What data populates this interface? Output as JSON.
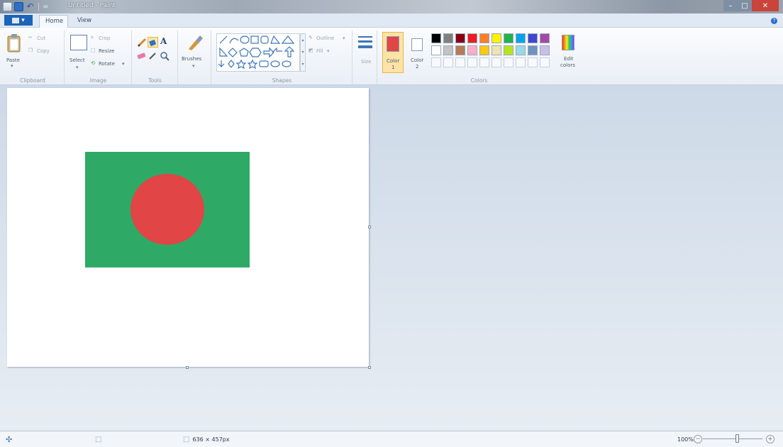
{
  "window": {
    "title": "Untitled - Paint",
    "minimize": "–",
    "maximize": "□",
    "close": "✕"
  },
  "quick_access": {
    "dropdown": "="
  },
  "tabs": {
    "file_label": "▾",
    "home_label": "Home",
    "view_label": "View",
    "help": "?"
  },
  "ribbon": {
    "clipboard": {
      "label": "Clipboard",
      "paste": "Paste",
      "cut": "Cut",
      "copy": "Copy"
    },
    "image": {
      "label": "Image",
      "select": "Select",
      "crop": "Crop",
      "resize": "Resize",
      "rotate": "Rotate"
    },
    "tools": {
      "label": "Tools",
      "text_tool": "A"
    },
    "brushes": {
      "label": "Brushes"
    },
    "shapes": {
      "label": "Shapes",
      "outline": "Outline",
      "fill": "Fill"
    },
    "size": {
      "label": "Size"
    },
    "colors": {
      "label": "Colors",
      "color1_label": "Color",
      "color1_num": "1",
      "color2_label": "Color",
      "color2_num": "2",
      "edit_colors_1": "Edit",
      "edit_colors_2": "colors",
      "color1_value": "#e14546",
      "color2_value": "#ffffff",
      "palette_row1": [
        "#000000",
        "#7f7f7f",
        "#880015",
        "#ed1c24",
        "#ff7f27",
        "#fff200",
        "#22b14c",
        "#00a2e8",
        "#3f48cc",
        "#a349a4"
      ],
      "palette_row2": [
        "#ffffff",
        "#c3c3c3",
        "#b97a57",
        "#ffaec9",
        "#ffc90e",
        "#efe4b0",
        "#b5e61d",
        "#99d9ea",
        "#7092be",
        "#c8bfe7"
      ]
    }
  },
  "canvas": {
    "background": "#ffffff",
    "flag_field_color": "#2eaa66",
    "flag_disc_color": "#e14546"
  },
  "status": {
    "image_size": "636 × 457px",
    "zoom": "100%",
    "zoom_out": "−",
    "zoom_in": "+"
  }
}
